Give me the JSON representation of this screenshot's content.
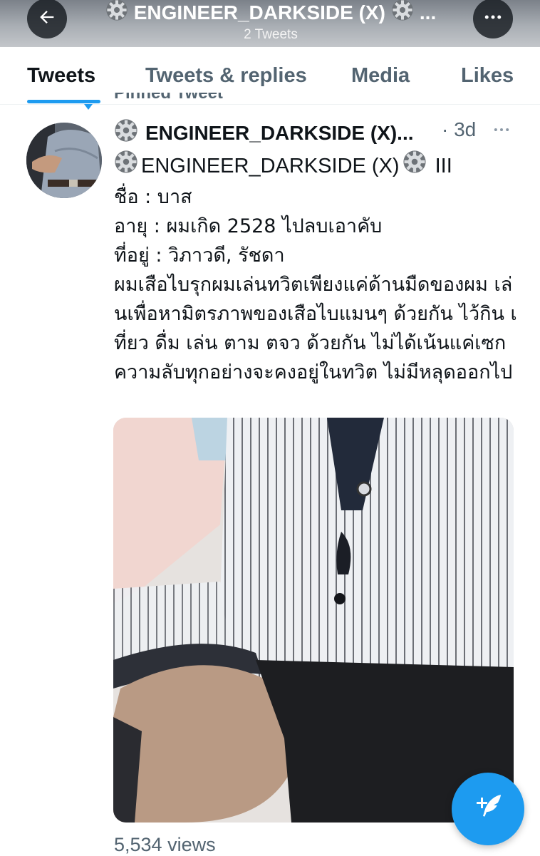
{
  "header": {
    "title": "ENGINEER_DARKSIDE (X)",
    "title_suffix": "...",
    "subtitle": "2 Tweets"
  },
  "tabs": [
    {
      "label": "Tweets",
      "active": true
    },
    {
      "label": "Tweets & replies",
      "active": false
    },
    {
      "label": "Media",
      "active": false
    },
    {
      "label": "Likes",
      "active": false
    }
  ],
  "pinned_label": "Pinned Tweet",
  "tweet": {
    "author": "ENGINEER_DARKSIDE (X)...",
    "time": "· 3d",
    "first_line_text": "ENGINEER_DARKSIDE (X)",
    "first_line_suffix": "III",
    "lines": [
      "ชื่อ : บาส",
      "อายุ : ผมเกิด 2528 ไปลบเอาคับ",
      "ที่อยู่ : วิภาวดี, รัชดา"
    ],
    "paragraph": "ผมเสือไบรุกผมเล่นทวิตเพียงแค่ด้านมืดของผม เล่นเพื่อหามิตรภาพของเสือไบแมนๆ ด้วยกัน ไว้กิน เที่ยว ดื่ม เล่น ตาม ตจว ด้วยกัน ไม่ได้เน้นแค่เซก ความลับทุกอย่างจะคงอยู่ในทวิต ไม่มีหลุดออกไป",
    "views": "5,534 views"
  },
  "icons": {
    "back": "arrow-left-icon",
    "more": "more-horizontal-icon",
    "gear": "gear-emoji-icon",
    "compose": "compose-feather-icon"
  },
  "colors": {
    "accent": "#1d9bf0",
    "muted": "#536471",
    "text": "#0f1419"
  }
}
